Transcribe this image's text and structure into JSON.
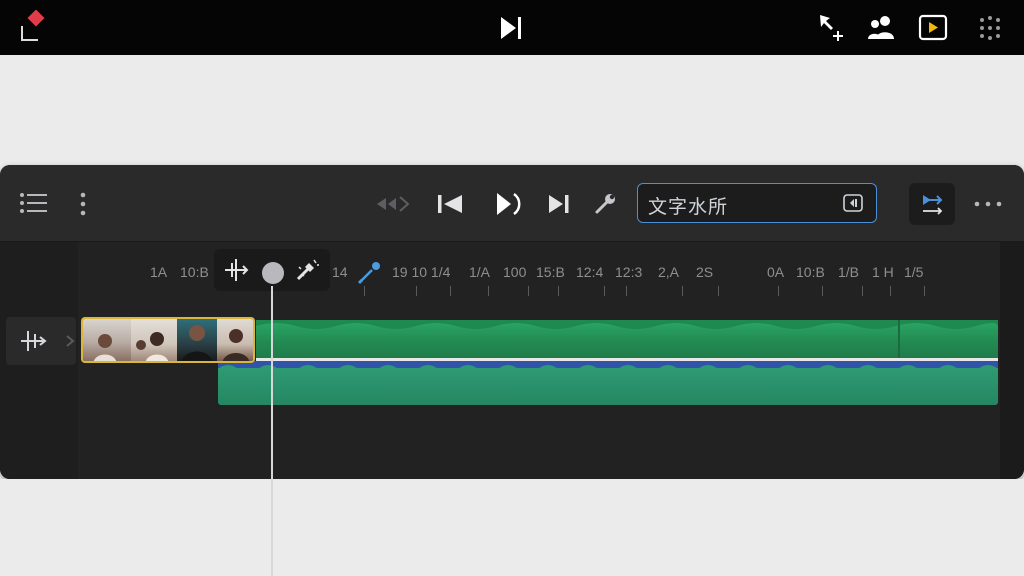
{
  "topbar": {
    "icons": [
      "project-marker-icon",
      "play-to-end-icon",
      "select-add-icon",
      "people-icon",
      "preview-play-icon",
      "grid-dots-icon"
    ]
  },
  "toolbar": {
    "search_value": "文字水所",
    "icons": [
      "list-icon",
      "more-vertical-icon",
      "rewind-audio-icon",
      "skip-back-icon",
      "play-icon",
      "skip-forward-icon",
      "wrench-icon",
      "export-icon",
      "more-horizontal-icon"
    ]
  },
  "ruler": {
    "labels": [
      {
        "text": "1A"
      },
      {
        "text": "10:B"
      },
      {
        "text": "14"
      },
      {
        "text": "19 10 1/4"
      },
      {
        "text": "1/A"
      },
      {
        "text": "100"
      },
      {
        "text": "15:B"
      },
      {
        "text": "12:4"
      },
      {
        "text": "12:3"
      },
      {
        "text": "2,A"
      },
      {
        "text": "2S"
      },
      {
        "text": "0A"
      },
      {
        "text": "10:B"
      },
      {
        "text": "1/B"
      },
      {
        "text": "1 H"
      },
      {
        "text": "1/5"
      }
    ]
  },
  "colors": {
    "accent_blue": "#4a8fd8",
    "clip_border": "#d8b73a",
    "green_track": "#2aa864",
    "teal_track": "#2e9a74",
    "blue_track": "#2f54a8",
    "brand_red": "#e23b4a"
  }
}
